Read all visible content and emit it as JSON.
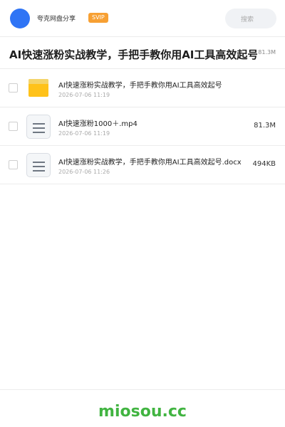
{
  "header": {
    "app_name": "夸克网盘分享",
    "badge": "SVIP",
    "search_placeholder": "搜索",
    "avatar_color": "#2f74f5"
  },
  "share": {
    "title": "AI快速涨粉实战教学，手把手教你用AI工具高效起号",
    "total_size": "81.3M"
  },
  "files": [
    {
      "type": "folder",
      "icon": "folder-icon",
      "name": "AI快速涨粉实战教学，手把手教你用AI工具高效起号",
      "date": "2026-07-06 11:19",
      "size": ""
    },
    {
      "type": "file",
      "icon": "document-icon",
      "name": "AI快速涨粉1000＋.mp4",
      "date": "2026-07-06 11:19",
      "size": "81.3M"
    },
    {
      "type": "file",
      "icon": "document-icon",
      "name": "AI快速涨粉实战教学，手把手教你用AI工具高效起号.docx",
      "date": "2026-07-06 11:26",
      "size": "494KB"
    }
  ],
  "footer": {
    "brand": "miosou.cc",
    "brand_color": "#41b441"
  }
}
